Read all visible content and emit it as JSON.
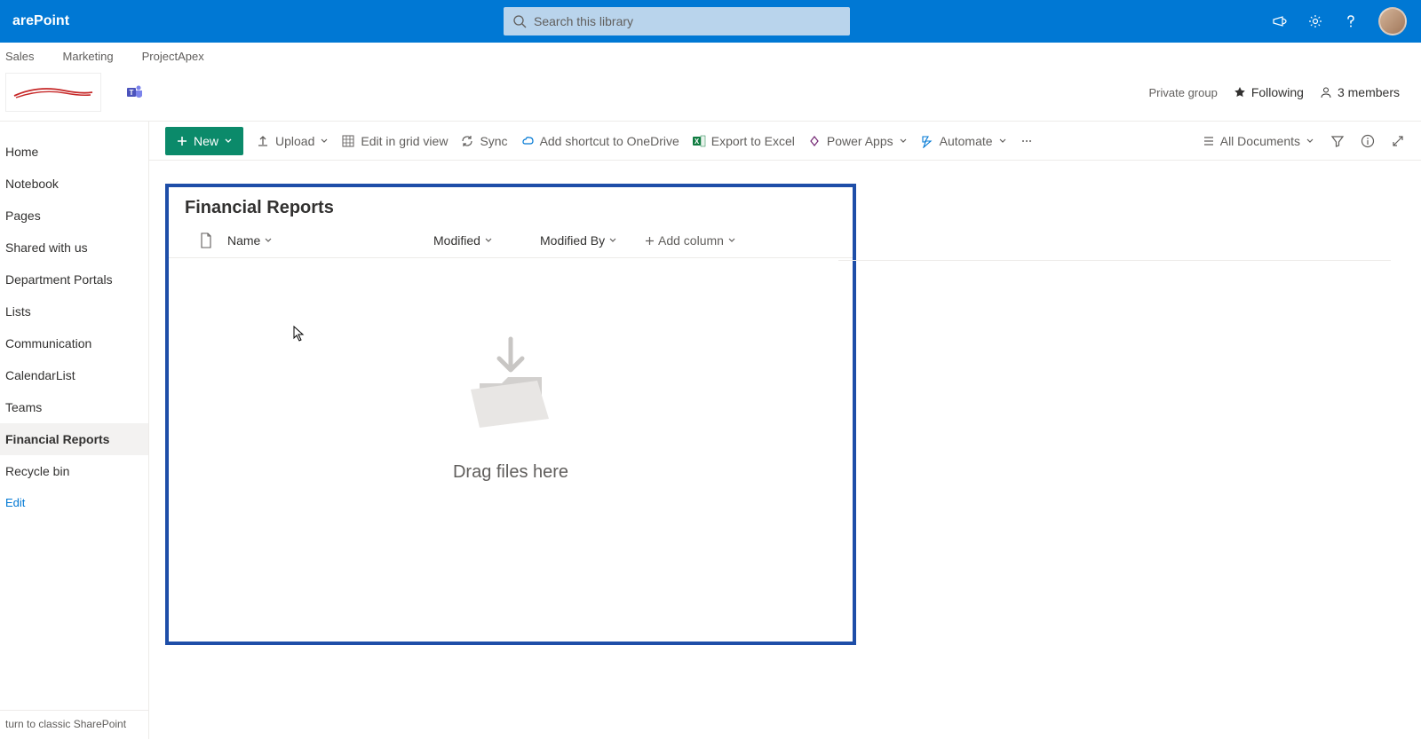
{
  "app": {
    "name": "arePoint"
  },
  "search": {
    "placeholder": "Search this library"
  },
  "hub_nav": [
    "Sales",
    "Marketing",
    "ProjectApex"
  ],
  "site_info": {
    "privacy": "Private group",
    "following": "Following",
    "members": "3 members"
  },
  "left_nav": {
    "items": [
      "Home",
      "Notebook",
      "Pages",
      "Shared with us",
      "Department Portals",
      "Lists",
      "Communication",
      "CalendarList",
      "Teams",
      "Financial Reports",
      "Recycle bin"
    ],
    "selected_index": 9,
    "edit": "Edit",
    "return": "turn to classic SharePoint"
  },
  "cmd_bar": {
    "new": "New",
    "upload": "Upload",
    "edit_grid": "Edit in grid view",
    "sync": "Sync",
    "shortcut": "Add shortcut to OneDrive",
    "export": "Export to Excel",
    "powerapps": "Power Apps",
    "automate": "Automate",
    "view": "All Documents"
  },
  "library": {
    "title": "Financial Reports",
    "columns": {
      "name": "Name",
      "modified": "Modified",
      "modified_by": "Modified By",
      "add": "Add column"
    },
    "empty": "Drag files here"
  }
}
